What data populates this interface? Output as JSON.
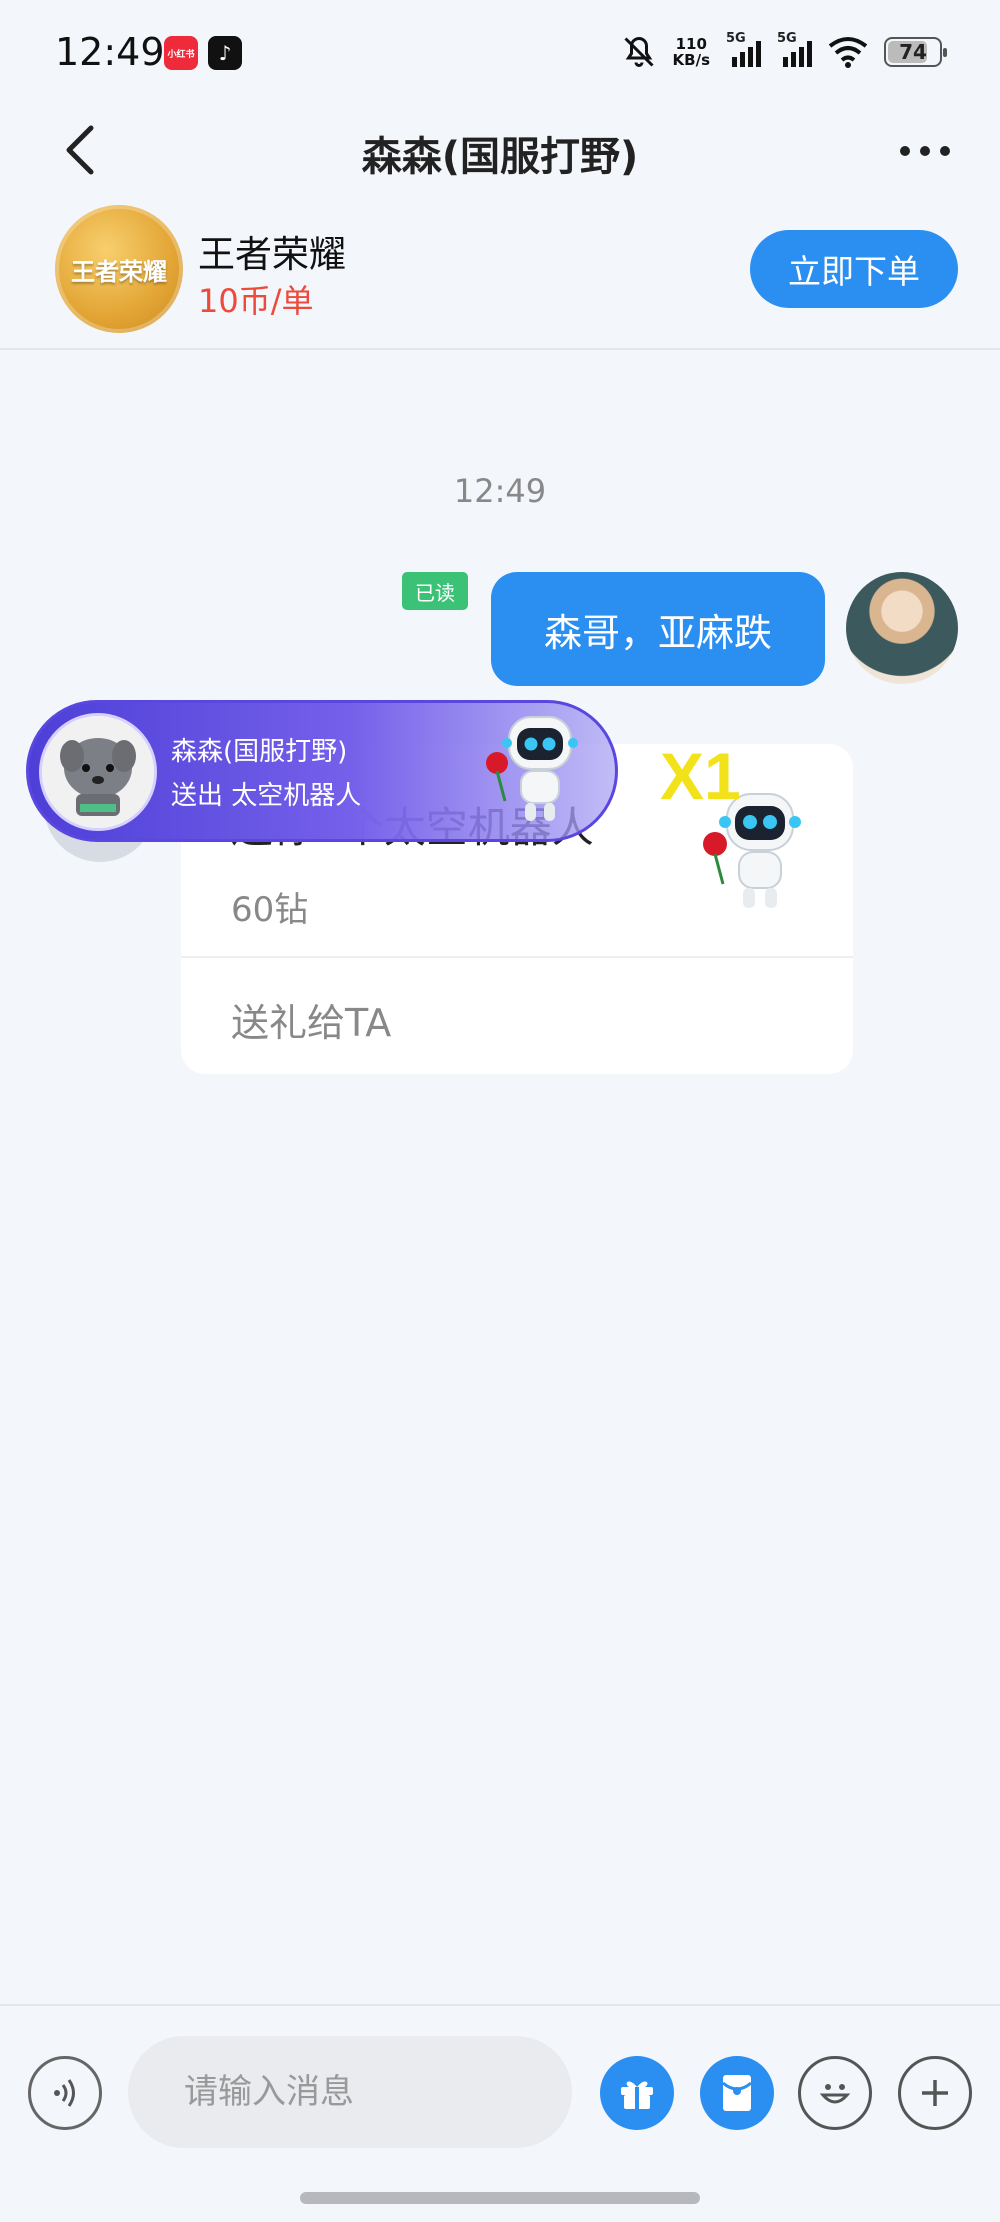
{
  "status_bar": {
    "time": "12:49",
    "net_speed_top": "110",
    "net_speed_bottom": "KB/s",
    "sim1_label": "5G",
    "sim2_label": "5G",
    "battery": "74",
    "app_badge_1": "小红书"
  },
  "header": {
    "title": "森森(国服打野)"
  },
  "game": {
    "name": "王者荣耀",
    "price": "10币/单",
    "logo_text": "王者荣耀",
    "order_button": "立即下单"
  },
  "chat": {
    "timestamp": "12:49",
    "read_badge": "已读",
    "my_message": "森哥，亚麻跌",
    "gift_card": {
      "title": "送你1个太空机器人",
      "cost": "60钻",
      "send_label": "送礼给TA"
    },
    "gift_multiplier": "X1"
  },
  "gift_banner": {
    "sender": "森森(国服打野)",
    "action": "送出  太空机器人"
  },
  "input_bar": {
    "placeholder": "请输入消息"
  },
  "colors": {
    "accent": "#2a8ff1",
    "price_red": "#ec4b3c",
    "read_green": "#3cc277",
    "banner_purple": "#4d3fd7"
  }
}
